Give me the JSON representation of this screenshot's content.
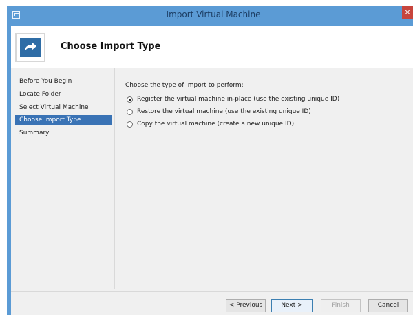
{
  "window": {
    "title": "Import Virtual Machine",
    "close_glyph": "×"
  },
  "header": {
    "icon": "arrow-right-curved-icon",
    "title": "Choose Import Type"
  },
  "sidebar": {
    "items": [
      {
        "label": "Before You Begin",
        "active": false
      },
      {
        "label": "Locate Folder",
        "active": false
      },
      {
        "label": "Select Virtual Machine",
        "active": false
      },
      {
        "label": "Choose Import Type",
        "active": true
      },
      {
        "label": "Summary",
        "active": false
      }
    ]
  },
  "content": {
    "prompt": "Choose the type of import to perform:",
    "options": [
      {
        "label": "Register the virtual machine in-place (use the existing unique ID)",
        "checked": true
      },
      {
        "label": "Restore the virtual machine (use the existing unique ID)",
        "checked": false
      },
      {
        "label": "Copy the virtual machine (create a new unique ID)",
        "checked": false
      }
    ]
  },
  "footer": {
    "previous": "< Previous",
    "next": "Next >",
    "finish": "Finish",
    "cancel": "Cancel"
  },
  "colors": {
    "title_bar": "#5b9bd5",
    "selected_nav": "#3a73b5",
    "client_bg": "#f0f0f0"
  }
}
